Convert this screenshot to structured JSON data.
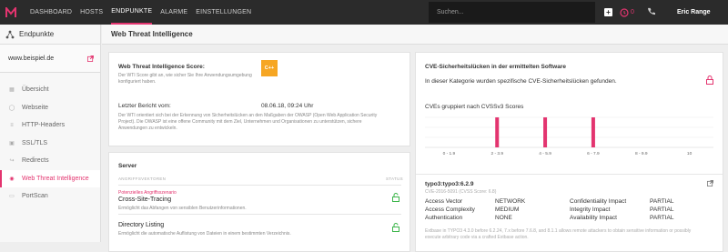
{
  "topbar": {
    "nav": [
      "DASHBOARD",
      "HOSTS",
      "ENDPUNKTE",
      "ALARME",
      "EINSTELLUNGEN"
    ],
    "active": "ENDPUNKTE",
    "search_placeholder": "Suchen...",
    "user": "Eric Range",
    "accent": "#e3346f"
  },
  "sidebar": {
    "title": "Endpunkte",
    "site": "www.beispiel.de",
    "items": [
      {
        "label": "Übersicht",
        "icon": "dashboard-icon"
      },
      {
        "label": "Webseite",
        "icon": "globe-icon"
      },
      {
        "label": "HTTP-Headers",
        "icon": "headers-icon"
      },
      {
        "label": "SSL/TLS",
        "icon": "lock-icon"
      },
      {
        "label": "Redirects",
        "icon": "redirect-icon"
      },
      {
        "label": "Web Threat Intelligence",
        "icon": "bulb-icon"
      },
      {
        "label": "PortScan",
        "icon": "portscan-icon"
      }
    ],
    "active_item": "Web Threat Intelligence"
  },
  "main": {
    "title": "Web Threat Intelligence",
    "wti": {
      "score_label": "Web Threat Intelligence Score:",
      "score_desc": "Der WTI Score gibt an, wie sicher Sie Ihre Anwendungsumgebung konfiguriert haben.",
      "score": "C++",
      "last_report_label": "Letzter Bericht vom:",
      "last_report_value": "08.06.18, 09:24 Uhr",
      "long_desc": "Der WTI orientiert sich bei der Erkennung von Sicherheitslücken an den Maßgaben der OWASP (Open Web Application Security Project). Die OWASP ist eine offene Community mit dem Ziel, Unternehmen und Organisationen zu unterstützen, sichere Anwendungen zu entwickeln."
    },
    "server": {
      "title": "Server",
      "col_vectors": "ANGRIFFSVEKTOREN",
      "col_status": "STATUS",
      "risk_label": "Potenzielles Angriffsszenario",
      "vuln1_title": "Cross-Site-Tracing",
      "vuln1_desc": "Ermöglicht das Abfangen von sensiblen Benutzerinformationen.",
      "vuln2_title": "Directory Listing",
      "vuln2_desc": "Ermöglicht die automatische Auflistung von Dateien in einem bestimmten Verzeichnis."
    },
    "cve": {
      "title": "CVE-Sicherheitslücken in der ermittelten Software",
      "desc": "In dieser Kategorie wurden spezifische CVE-Sicherheitslücken gefunden.",
      "chart_title": "CVEs gruppiert nach CVSSv3 Scores",
      "detail_title": "typo3:typo3:6.2.9",
      "detail_id": "CVE-2016-5091 (CVSS Score: 6.8)",
      "details": [
        [
          "Access Vector",
          "NETWORK",
          "Confidentiality Impact",
          "PARTIAL"
        ],
        [
          "Access Complexity",
          "MEDIUM",
          "Integrity Impact",
          "PARTIAL"
        ],
        [
          "Authentication",
          "NONE",
          "Availability Impact",
          "PARTIAL"
        ]
      ],
      "detail_desc": "Extbase in TYPO3 4.3.0 before 6.2.24, 7.x before 7.6.8, and 8.1.1 allows remote attackers to obtain sensitive information or possibly execute arbitrary code via a crafted Extbase action."
    }
  },
  "chart_data": {
    "type": "bar",
    "title": "CVEs gruppiert nach CVSSv3 Scores",
    "categories": [
      "0 - 1.9",
      "2 - 3.9",
      "4 - 5.9",
      "6 - 7.9",
      "8 - 9.9",
      "10"
    ],
    "values": [
      0,
      1,
      1,
      1,
      0,
      0
    ],
    "bar_color": "#e3346f"
  }
}
